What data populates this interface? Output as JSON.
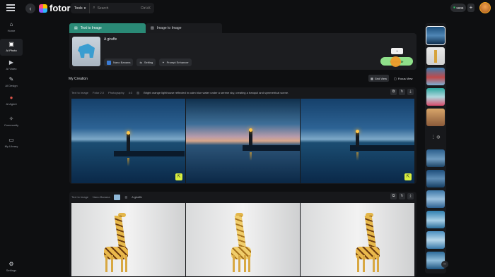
{
  "header": {
    "logo_text": "fotor",
    "tools_label": "Tools",
    "search_placeholder": "Search",
    "shortcut": "Ctrl+K",
    "credits": "5808"
  },
  "sidebar": {
    "items": [
      {
        "label": "Home",
        "icon": "home-icon",
        "glyph": "⌂"
      },
      {
        "label": "AI Photo",
        "icon": "photo-icon",
        "glyph": "▣"
      },
      {
        "label": "AI Video",
        "icon": "video-icon",
        "glyph": "▶"
      },
      {
        "label": "AI Design",
        "icon": "design-icon",
        "glyph": "✎"
      },
      {
        "label": "AI Agent",
        "icon": "agent-icon",
        "glyph": "●"
      },
      {
        "label": "Community",
        "icon": "community-icon",
        "glyph": "✧"
      },
      {
        "label": "My Library",
        "icon": "folder-icon",
        "glyph": "▭"
      },
      {
        "label": "Settings",
        "icon": "gear-icon",
        "glyph": "⚙"
      }
    ]
  },
  "tabs": [
    {
      "label": "Text to Image",
      "active": true
    },
    {
      "label": "Image to Image",
      "active": false
    }
  ],
  "prompt_card": {
    "prompt": "A giraffe",
    "count": "1",
    "generate_label": "Generate",
    "chips": [
      {
        "label": "Nano Banana",
        "icon": "model-icon"
      },
      {
        "label": "Setting",
        "icon": "sliders-icon"
      },
      {
        "label": "Prompt Enhancer",
        "icon": "sparkle-icon"
      }
    ]
  },
  "creation": {
    "title": "My Creation",
    "grid_view": "Grid View",
    "focus_view": "Focus View"
  },
  "groups": [
    {
      "mode": "Text to Image",
      "model": "Fotor 2.0",
      "style": "Photography",
      "ratio": "4:3",
      "prompt": "Bright orange lighthouse reflected in calm blue water under a serene sky, creating a tranquil and symmetrical scene."
    },
    {
      "mode": "Text to Image",
      "model": "Nano Banana",
      "prompt": "A giraffe"
    }
  ],
  "colors": {
    "accent": "#2a8a76",
    "generate": "#8fe08a",
    "save_tag": "#d9ef3e",
    "cursor": "#f09a2a"
  }
}
